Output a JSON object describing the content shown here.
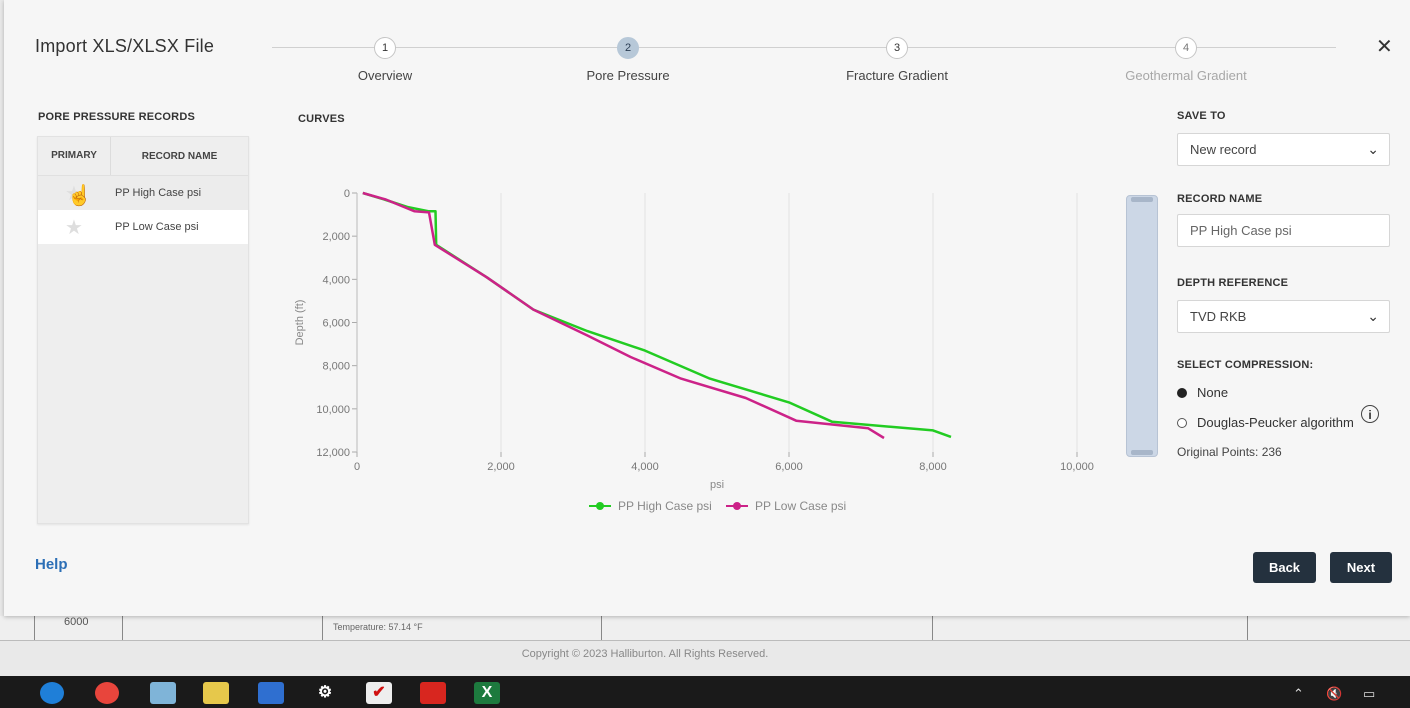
{
  "modal": {
    "title": "Import XLS/XLSX File",
    "steps": [
      {
        "number": "1",
        "label": "Overview",
        "state": "done"
      },
      {
        "number": "2",
        "label": "Pore Pressure",
        "state": "active"
      },
      {
        "number": "3",
        "label": "Fracture Gradient",
        "state": "pending"
      },
      {
        "number": "4",
        "label": "Geothermal Gradient",
        "state": "disabled"
      }
    ]
  },
  "records": {
    "section_label": "PORE PRESSURE RECORDS",
    "col_primary": "PRIMARY",
    "col_name": "RECORD NAME",
    "rows": [
      {
        "name": "PP High Case psi"
      },
      {
        "name": "PP Low Case psi"
      }
    ]
  },
  "curves_label": "CURVES",
  "chart_data": {
    "type": "line",
    "xlabel": "psi",
    "ylabel": "Depth (ft)",
    "xlim": [
      0,
      10000
    ],
    "ylim": [
      0,
      12000
    ],
    "y_inverted": true,
    "x_ticks": [
      "0",
      "2,000",
      "4,000",
      "6,000",
      "8,000",
      "10,000"
    ],
    "x_tick_values": [
      0,
      2000,
      4000,
      6000,
      8000,
      10000
    ],
    "y_ticks": [
      "0",
      "2,000",
      "4,000",
      "6,000",
      "8,000",
      "10,000",
      "12,000"
    ],
    "y_tick_values": [
      0,
      2000,
      4000,
      6000,
      8000,
      10000,
      12000
    ],
    "grid": true,
    "legend": "bottom-center",
    "series": [
      {
        "name": "PP High Case psi",
        "color": "#22cc22",
        "points": [
          [
            80,
            0
          ],
          [
            380,
            300
          ],
          [
            700,
            650
          ],
          [
            1000,
            850
          ],
          [
            1090,
            850
          ],
          [
            1100,
            2400
          ],
          [
            1800,
            3900
          ],
          [
            2450,
            5400
          ],
          [
            3200,
            6400
          ],
          [
            4000,
            7300
          ],
          [
            4900,
            8600
          ],
          [
            6000,
            9700
          ],
          [
            6600,
            10600
          ],
          [
            8000,
            11000
          ],
          [
            8250,
            11300
          ]
        ]
      },
      {
        "name": "PP Low Case psi",
        "color": "#cc2288",
        "points": [
          [
            80,
            0
          ],
          [
            400,
            300
          ],
          [
            800,
            850
          ],
          [
            1000,
            900
          ],
          [
            1080,
            2400
          ],
          [
            1800,
            3900
          ],
          [
            2450,
            5400
          ],
          [
            3200,
            6600
          ],
          [
            3800,
            7600
          ],
          [
            4500,
            8600
          ],
          [
            5400,
            9500
          ],
          [
            6100,
            10550
          ],
          [
            7100,
            10900
          ],
          [
            7320,
            11350
          ]
        ]
      }
    ]
  },
  "save_to": {
    "label": "SAVE TO",
    "value": "New record"
  },
  "record_name": {
    "label": "RECORD NAME",
    "value": "PP High Case psi"
  },
  "depth_reference": {
    "label": "DEPTH REFERENCE",
    "value": "TVD RKB"
  },
  "compression": {
    "label": "SELECT COMPRESSION:",
    "options": [
      {
        "label": "None",
        "selected": true
      },
      {
        "label": "Douglas-Peucker algorithm",
        "selected": false
      }
    ],
    "original_points": "Original Points: 236"
  },
  "footer": {
    "help": "Help",
    "back": "Back",
    "next": "Next"
  },
  "background": {
    "depth_value": "6000",
    "temperature": "Temperature: 57.14 °F",
    "copyright": "Copyright © 2023 Halliburton. All Rights Reserved."
  }
}
